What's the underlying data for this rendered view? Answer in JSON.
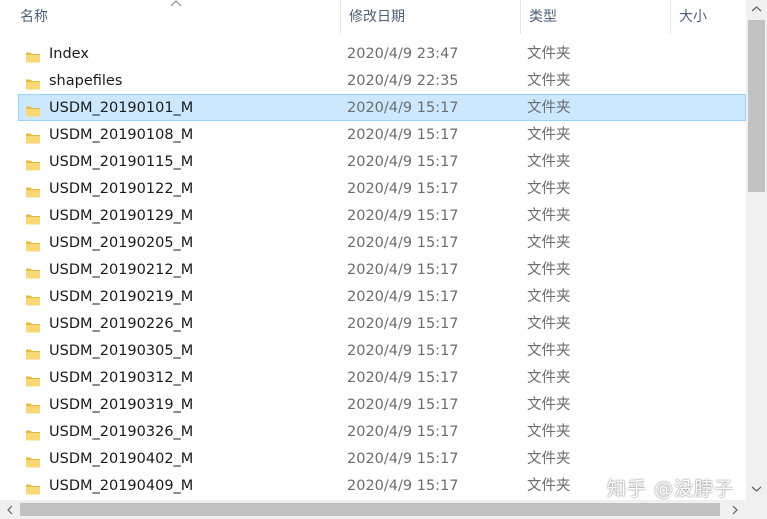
{
  "columns": {
    "name": "名称",
    "date_modified": "修改日期",
    "type": "类型",
    "size": "大小"
  },
  "sort": {
    "column": "name",
    "direction": "ascending"
  },
  "selected_index": 2,
  "files": [
    {
      "name": "Index",
      "date": "2020/4/9 23:47",
      "type": "文件夹"
    },
    {
      "name": "shapefiles",
      "date": "2020/4/9 22:35",
      "type": "文件夹"
    },
    {
      "name": "USDM_20190101_M",
      "date": "2020/4/9 15:17",
      "type": "文件夹"
    },
    {
      "name": "USDM_20190108_M",
      "date": "2020/4/9 15:17",
      "type": "文件夹"
    },
    {
      "name": "USDM_20190115_M",
      "date": "2020/4/9 15:17",
      "type": "文件夹"
    },
    {
      "name": "USDM_20190122_M",
      "date": "2020/4/9 15:17",
      "type": "文件夹"
    },
    {
      "name": "USDM_20190129_M",
      "date": "2020/4/9 15:17",
      "type": "文件夹"
    },
    {
      "name": "USDM_20190205_M",
      "date": "2020/4/9 15:17",
      "type": "文件夹"
    },
    {
      "name": "USDM_20190212_M",
      "date": "2020/4/9 15:17",
      "type": "文件夹"
    },
    {
      "name": "USDM_20190219_M",
      "date": "2020/4/9 15:17",
      "type": "文件夹"
    },
    {
      "name": "USDM_20190226_M",
      "date": "2020/4/9 15:17",
      "type": "文件夹"
    },
    {
      "name": "USDM_20190305_M",
      "date": "2020/4/9 15:17",
      "type": "文件夹"
    },
    {
      "name": "USDM_20190312_M",
      "date": "2020/4/9 15:17",
      "type": "文件夹"
    },
    {
      "name": "USDM_20190319_M",
      "date": "2020/4/9 15:17",
      "type": "文件夹"
    },
    {
      "name": "USDM_20190326_M",
      "date": "2020/4/9 15:17",
      "type": "文件夹"
    },
    {
      "name": "USDM_20190402_M",
      "date": "2020/4/9 15:17",
      "type": "文件夹"
    },
    {
      "name": "USDM_20190409_M",
      "date": "2020/4/9 15:17",
      "type": "文件夹"
    }
  ],
  "watermark": "知乎 @没脖子",
  "icons": {
    "folder": "folder-icon",
    "sort": "sort-ascending-icon"
  },
  "colors": {
    "selection": "#cce8ff",
    "selection_border": "#99d1ff",
    "folder": "#f8d775",
    "header_text": "#4c607a",
    "secondary_text": "#6d6d6d"
  }
}
